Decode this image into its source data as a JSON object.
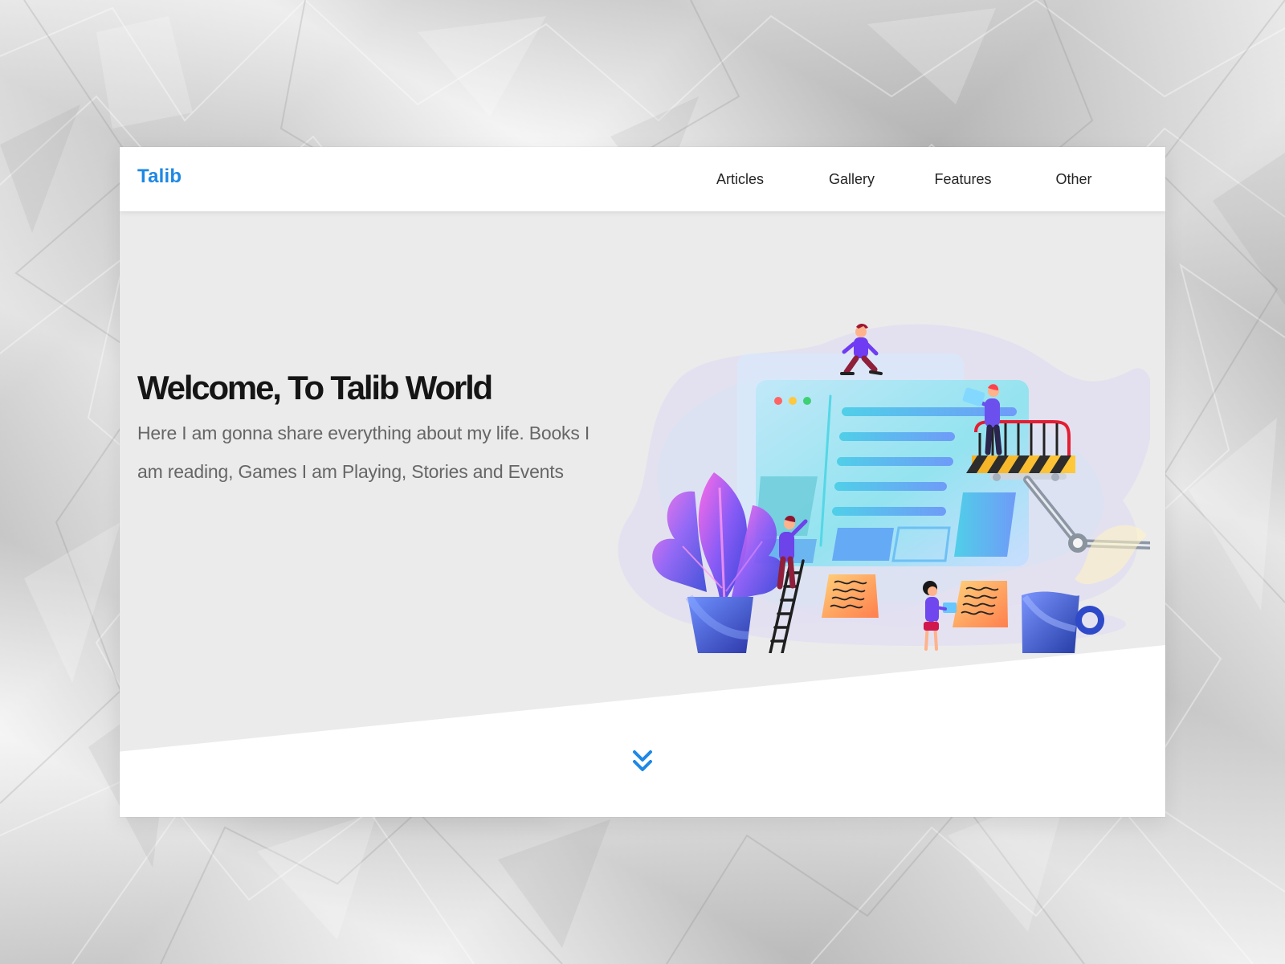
{
  "brand": {
    "name": "Talib",
    "color": "#1e88e5"
  },
  "navigation": [
    {
      "label": "Articles"
    },
    {
      "label": "Gallery"
    },
    {
      "label": "Features"
    },
    {
      "label": "Other"
    }
  ],
  "hero": {
    "title": "Welcome, To Talib World",
    "description": "Here I am gonna share everything about my life. Books I am reading, Games I am Playing, Stories and Events"
  },
  "icons": {
    "scroll_down": "double-chevron-down-icon"
  },
  "colors": {
    "accent": "#1e88e5",
    "text": "#151515",
    "muted_text": "#666666",
    "hero_background": "#ebebeb",
    "card_background": "#ffffff"
  }
}
